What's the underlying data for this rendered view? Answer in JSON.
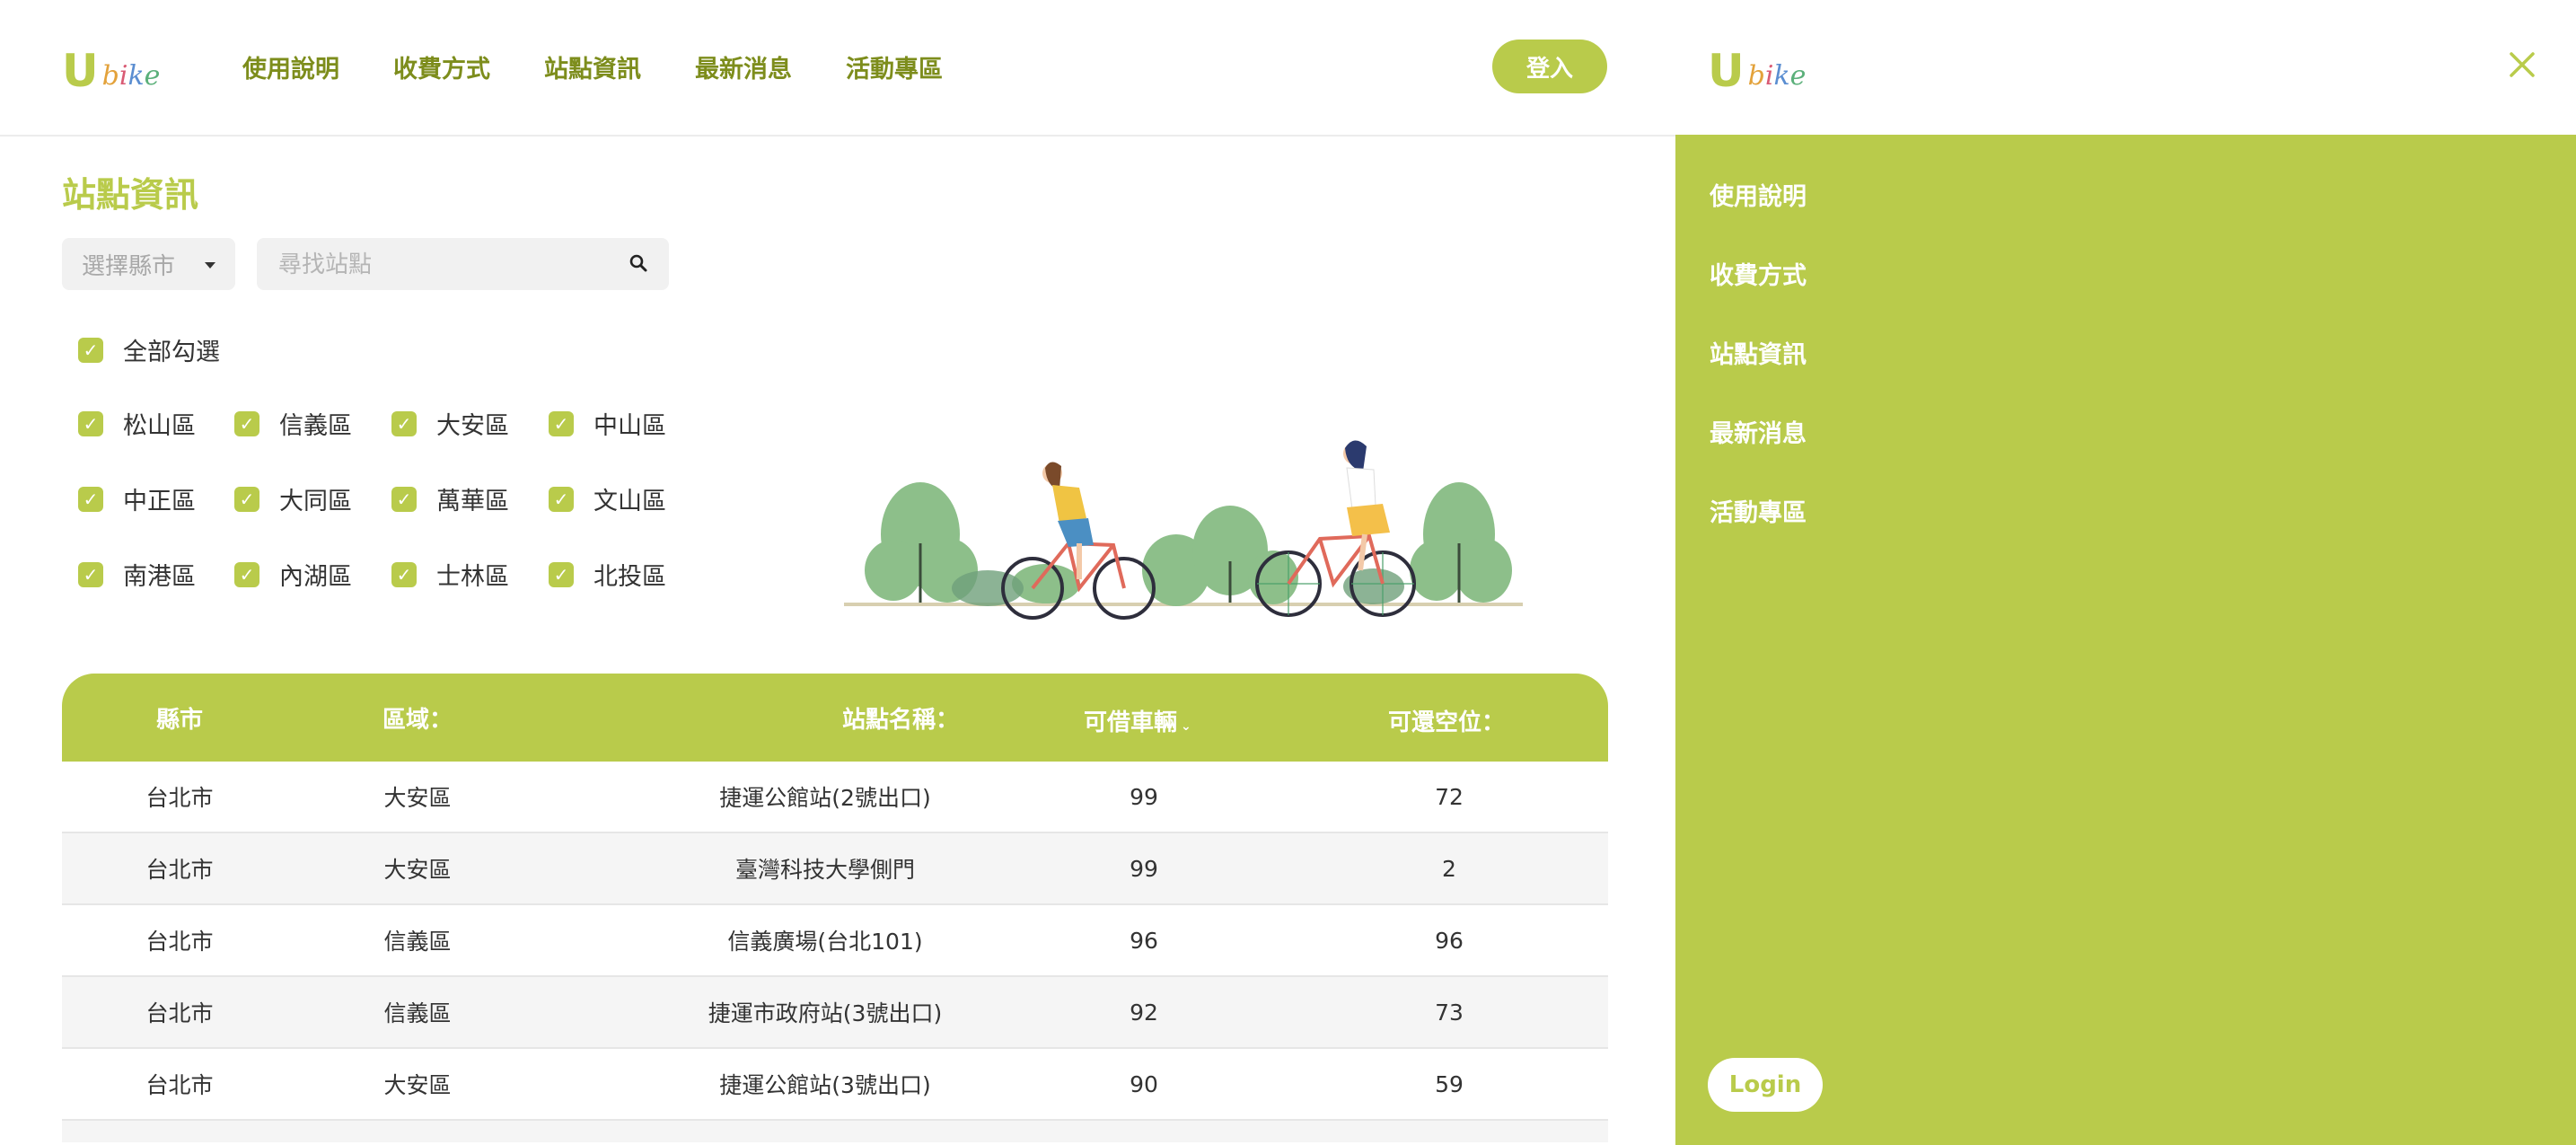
{
  "brand": {
    "logo_u": "U",
    "logo_bike": [
      "b",
      "i",
      "k",
      "e"
    ]
  },
  "nav": [
    "使用說明",
    "收費方式",
    "站點資訊",
    "最新消息",
    "活動專區"
  ],
  "header": {
    "login_label": "登入"
  },
  "page_title": "站點資訊",
  "filters": {
    "city_select": "選擇縣市",
    "search_placeholder": "尋找站點",
    "select_all": "全部勾選",
    "districts": [
      "松山區",
      "信義區",
      "大安區",
      "中山區",
      "中正區",
      "大同區",
      "萬華區",
      "文山區",
      "南港區",
      "內湖區",
      "士林區",
      "北投區"
    ]
  },
  "table": {
    "headers": [
      "縣市",
      "區域：",
      "站點名稱：",
      "可借車輛",
      "可還空位："
    ],
    "rows": [
      [
        "台北市",
        "大安區",
        "捷運公館站(2號出口)",
        "99",
        "72"
      ],
      [
        "台北市",
        "大安區",
        "臺灣科技大學側門",
        "99",
        "2"
      ],
      [
        "台北市",
        "信義區",
        "信義廣場(台北101)",
        "96",
        "96"
      ],
      [
        "台北市",
        "信義區",
        "捷運市政府站(3號出口)",
        "92",
        "73"
      ],
      [
        "台北市",
        "大安區",
        "捷運公館站(3號出口)",
        "90",
        "59"
      ]
    ]
  },
  "drawer": {
    "menu": [
      "使用說明",
      "收費方式",
      "站點資訊",
      "最新消息",
      "活動專區"
    ],
    "login_label": "Login"
  },
  "colors": {
    "accent": "#b9cb4b",
    "nav_text": "#7d8d1c"
  },
  "icons": {
    "search": "search-icon",
    "close": "close-icon",
    "checkbox": "check-icon",
    "caret": "caret-down-icon",
    "sort": "sort-caret-icon"
  }
}
